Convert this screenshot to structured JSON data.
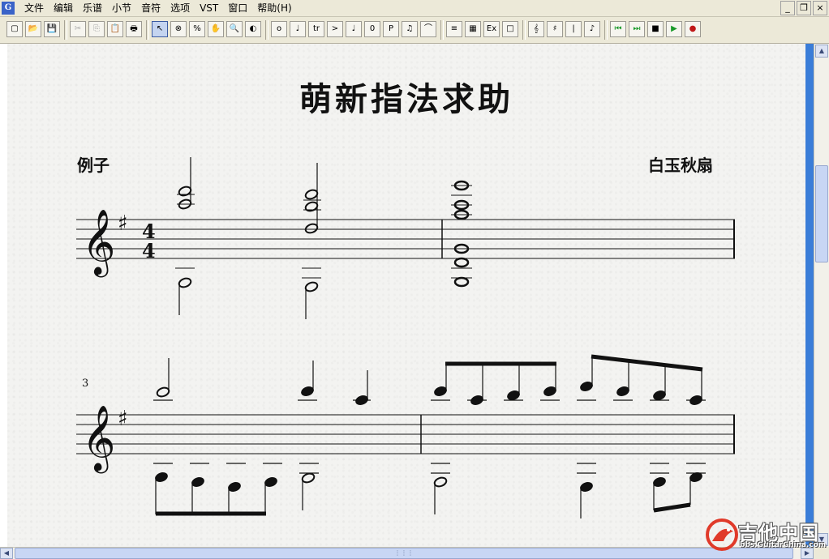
{
  "menubar": {
    "app_icon": "guitar-pro-icon",
    "items": [
      "文件",
      "编辑",
      "乐谱",
      "小节",
      "音符",
      "选项",
      "VST",
      "窗口",
      "帮助(H)"
    ],
    "window_buttons": [
      "_",
      "❐",
      "×"
    ]
  },
  "toolbar": {
    "buttons": [
      {
        "name": "new-file",
        "glyph": "▢",
        "state": "normal"
      },
      {
        "name": "open-file",
        "glyph": "📂",
        "state": "normal"
      },
      {
        "name": "save-file",
        "glyph": "💾",
        "state": "normal"
      },
      {
        "name": "cut",
        "glyph": "✂",
        "state": "disabled"
      },
      {
        "name": "copy",
        "glyph": "⎘",
        "state": "disabled"
      },
      {
        "name": "paste",
        "glyph": "📋",
        "state": "disabled"
      },
      {
        "name": "print",
        "glyph": "🖶",
        "state": "normal"
      },
      {
        "name": "select-arrow",
        "glyph": "↖",
        "state": "active"
      },
      {
        "name": "delete-note",
        "glyph": "⊗",
        "state": "normal"
      },
      {
        "name": "percent",
        "glyph": "%",
        "state": "normal"
      },
      {
        "name": "hand-tool",
        "glyph": "✋",
        "state": "normal"
      },
      {
        "name": "zoom",
        "glyph": "🔍",
        "state": "normal"
      },
      {
        "name": "color-wheel",
        "glyph": "◐",
        "state": "normal"
      },
      {
        "name": "whole-note",
        "glyph": "o",
        "state": "normal"
      },
      {
        "name": "tie",
        "glyph": "♩",
        "state": "normal"
      },
      {
        "name": "trill",
        "glyph": "tr",
        "state": "normal"
      },
      {
        "name": "accent",
        "glyph": ">",
        "state": "normal"
      },
      {
        "name": "quarter-note",
        "glyph": "♩",
        "state": "normal"
      },
      {
        "name": "zero",
        "glyph": "0",
        "state": "normal"
      },
      {
        "name": "piano-dynamic",
        "glyph": "P",
        "state": "normal"
      },
      {
        "name": "beam-notes",
        "glyph": "♫",
        "state": "normal"
      },
      {
        "name": "slur",
        "glyph": "⌒",
        "state": "normal"
      },
      {
        "name": "tremolo",
        "glyph": "≡",
        "state": "normal"
      },
      {
        "name": "grid",
        "glyph": "▦",
        "state": "normal"
      },
      {
        "name": "expression",
        "glyph": "Ex",
        "state": "normal"
      },
      {
        "name": "empty-box",
        "glyph": "□",
        "state": "normal"
      },
      {
        "name": "treble-clef",
        "glyph": "𝄞",
        "state": "normal"
      },
      {
        "name": "tuning",
        "glyph": "♯",
        "state": "normal"
      },
      {
        "name": "bar-line",
        "glyph": "|",
        "state": "normal"
      },
      {
        "name": "note-props",
        "glyph": "♪",
        "state": "normal"
      },
      {
        "name": "rewind",
        "glyph": "⏮",
        "state": "green"
      },
      {
        "name": "play-step",
        "glyph": "⏭",
        "state": "green"
      },
      {
        "name": "stop",
        "glyph": "■",
        "state": "normal"
      },
      {
        "name": "play",
        "glyph": "▶",
        "state": "green"
      },
      {
        "name": "record",
        "glyph": "●",
        "state": "red"
      }
    ]
  },
  "score": {
    "title": "萌新指法求助",
    "left_subtitle": "例子",
    "right_subtitle": "白玉秋扇",
    "time_signature": {
      "top": "4",
      "bottom": "4"
    },
    "measure_number_system2": "3"
  },
  "watermark": {
    "text": "吉他中国",
    "subtext": "bbs.GuitarChina.com"
  }
}
